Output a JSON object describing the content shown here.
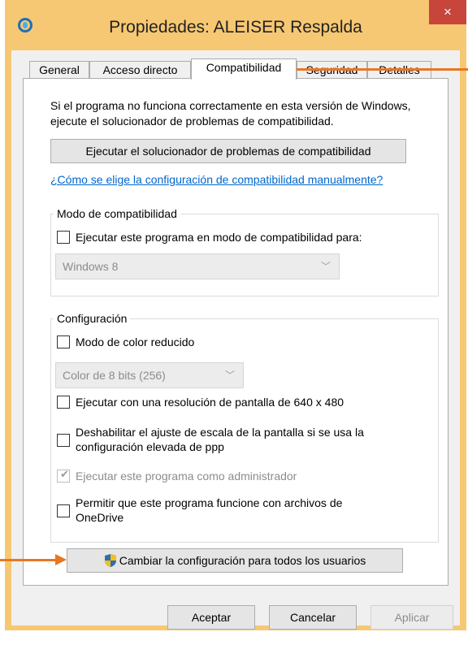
{
  "window": {
    "title": "Propiedades: ALEISER Respalda",
    "close_glyph": "×"
  },
  "tabs": [
    "General",
    "Acceso directo",
    "Compatibilidad",
    "Seguridad",
    "Detalles"
  ],
  "active_tab": "Compatibilidad",
  "description": "Si el programa no funciona correctamente en esta versión de Windows, ejecute el solucionador de problemas de compatibilidad.",
  "troubleshooter_button": "Ejecutar el solucionador de problemas de compatibilidad",
  "manual_link": "¿Cómo se elige la configuración de compatibilidad manualmente?",
  "compat_mode": {
    "group_title": "Modo de compatibilidad",
    "checkbox_label": "Ejecutar este programa en modo de compatibilidad para:",
    "checked": false,
    "select_value": "Windows 8"
  },
  "settings": {
    "group_title": "Configuración",
    "reduced_color_label": "Modo de color reducido",
    "color_select_value": "Color de 8 bits (256)",
    "resolution_label": "Ejecutar con una resolución de pantalla de 640 x 480",
    "dpi_label_line1": "Deshabilitar el ajuste de escala de la pantalla si se usa la",
    "dpi_label_line2": "configuración elevada de ppp",
    "admin_label": "Ejecutar este programa como administrador",
    "admin_checked": true,
    "onedrive_label_line1": "Permitir que este programa funcione con archivos de",
    "onedrive_label_line2": "OneDrive"
  },
  "all_users_button": "Cambiar la configuración para todos los usuarios",
  "footer": {
    "ok": "Aceptar",
    "cancel": "Cancelar",
    "apply": "Aplicar"
  },
  "colors": {
    "window_frame": "#f7c873",
    "close_button": "#c7453b",
    "annotation_arrow": "#e87722",
    "link": "#0066cc"
  },
  "icons": [
    "app-icon",
    "close-icon",
    "uac-shield-icon",
    "chevron-down-icon"
  ]
}
